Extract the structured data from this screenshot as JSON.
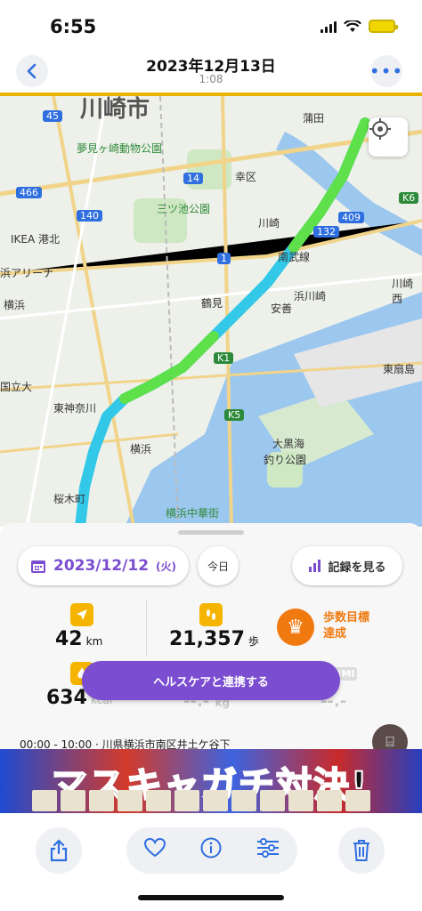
{
  "status_bar": {
    "time": "6:55"
  },
  "nav": {
    "title": "2023年12月13日",
    "subtitle": "1:08"
  },
  "map": {
    "labels": {
      "kawasaki_city": "川崎市",
      "yumemigasaki": "夢見ヶ崎動物公園",
      "saiwai": "幸区",
      "mitsuike": "三ツ池公園",
      "kawasaki_st": "川崎",
      "ikea": "IKEA 港北",
      "arena": "浜アリーナ",
      "yokohama_n": "横浜",
      "tsurumi": "鶴見",
      "hamakawasaki": "浜川崎",
      "anzen": "安善",
      "higashi_ogishima": "東扇島",
      "kawasakinisi": "川崎西",
      "kokuritsu": "国立大",
      "higashikanagawa": "東神奈川",
      "yokohama": "横浜",
      "daikokufuto": "大黒海",
      "tsuri": "釣り公園",
      "sakuragicho": "桜木町",
      "chukagai": "横浜中華街",
      "kamata": "蒲田",
      "nanbu": "南武線",
      "route_45": "45",
      "route_466": "466",
      "route_140": "140",
      "route_14": "14",
      "route_409": "409",
      "route_132": "132",
      "route_k6": "K6",
      "route_k1": "K1",
      "route_k5": "K5",
      "route_1": "1"
    }
  },
  "summary": {
    "date": "2023/12/12",
    "weekday": "(火)",
    "today_label": "今日",
    "records_label": "記録を見る",
    "distance_value": "42",
    "distance_unit": "km",
    "steps_value": "21,357",
    "steps_unit": "歩",
    "goal_label_1": "歩数目標",
    "goal_label_2": "達成",
    "calories_value": "634",
    "calories_unit": "kcal",
    "weight_value": "--.-",
    "weight_unit": "kg",
    "bmi_label": "BMI",
    "bmi_value": "--.-",
    "health_button": "ヘルスケアと連携する",
    "log_entry": "00:00 - 10:00 · 川県横浜市南区井土ケ谷下"
  },
  "banner": {
    "headline": "マスキャガチ対決!"
  },
  "colors": {
    "accent": "#7b4dd0",
    "ios_blue": "#2f6fe0",
    "orange": "#f07a10",
    "stat_yellow": "#f5b400",
    "route_green": "#5de04a",
    "route_cyan": "#33c8e8"
  }
}
